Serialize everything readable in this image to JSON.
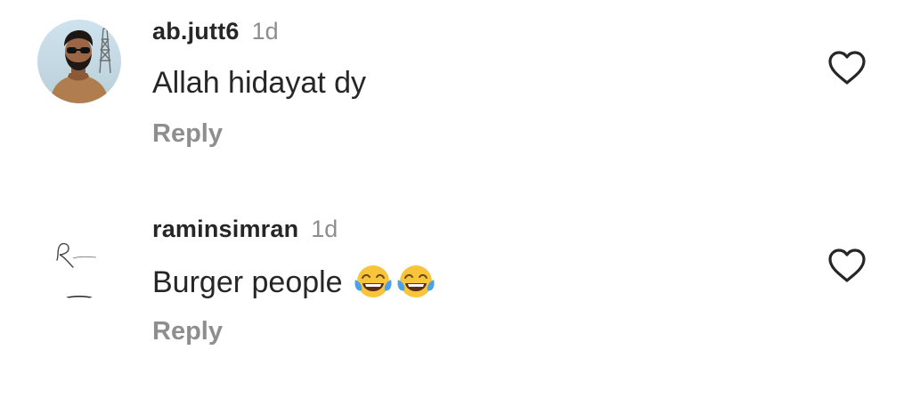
{
  "comments": [
    {
      "username": "ab.jutt6",
      "time": "1d",
      "text": "Allah hidayat dy",
      "emojis": [],
      "reply_label": "Reply",
      "avatar_icon": "profile-photo-man-sunglasses",
      "like_icon": "heart-outline-icon"
    },
    {
      "username": "raminsimran",
      "time": "1d",
      "text": "Burger people",
      "emojis": [
        "face-with-tears-of-joy-icon",
        "face-with-tears-of-joy-icon"
      ],
      "reply_label": "Reply",
      "avatar_icon": "handwritten-logo-avatar",
      "like_icon": "heart-outline-icon"
    }
  ],
  "colors": {
    "text_primary": "#262626",
    "text_secondary": "#8e8e8e",
    "background": "#ffffff"
  }
}
